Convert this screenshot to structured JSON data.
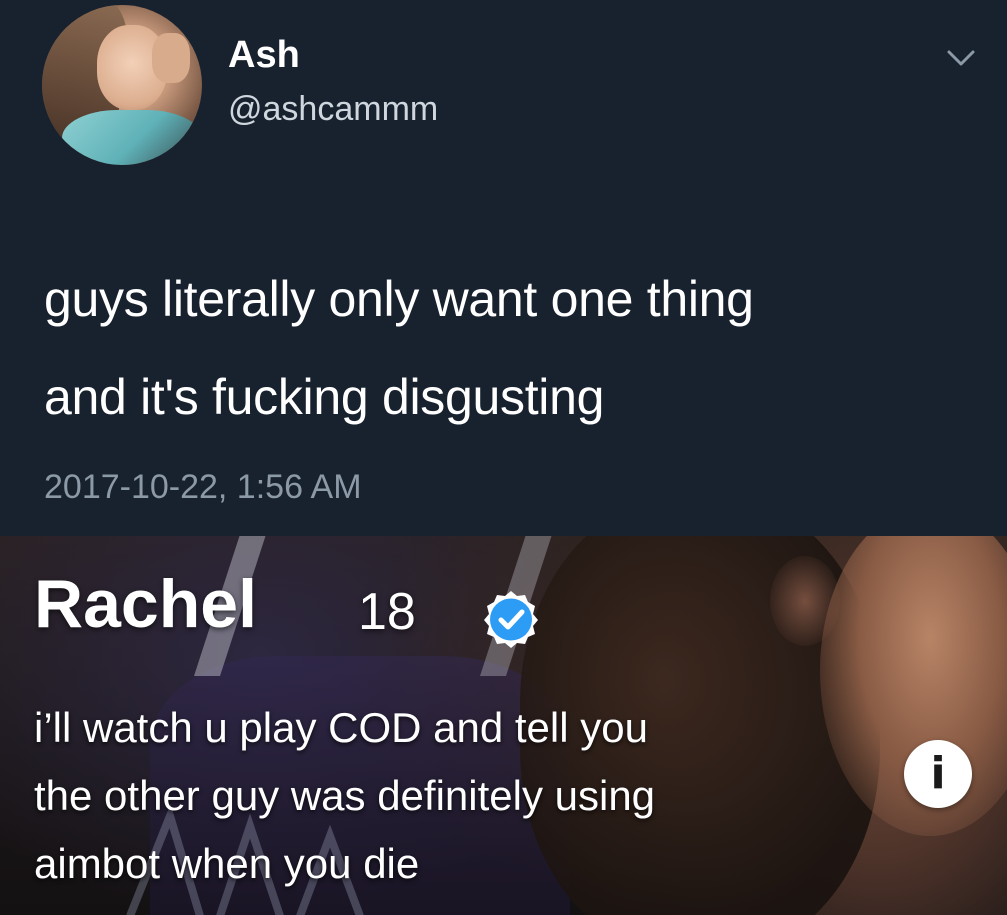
{
  "tweet": {
    "author_name": "Ash",
    "author_handle": "@ashcammm",
    "text_lines": [
      "guys literally only want one thing",
      "and it's fucking disgusting"
    ],
    "timestamp": "2017-10-22, 1:56 AM",
    "menu_icon": "chevron-down-icon",
    "colors": {
      "background": "#18222e",
      "text": "#ffffff",
      "secondary_text": "#8c99a6"
    }
  },
  "profile_card": {
    "name": "Rachel",
    "age": "18",
    "verified_icon": "verified-badge-icon",
    "bio_lines": [
      "i’ll watch u play COD and tell you",
      "the other guy was definitely using",
      "aimbot when you die"
    ],
    "info_icon_glyph": "i",
    "info_icon": "info-icon",
    "colors": {
      "verified": "#2d9cf4",
      "text": "#ffffff"
    }
  }
}
